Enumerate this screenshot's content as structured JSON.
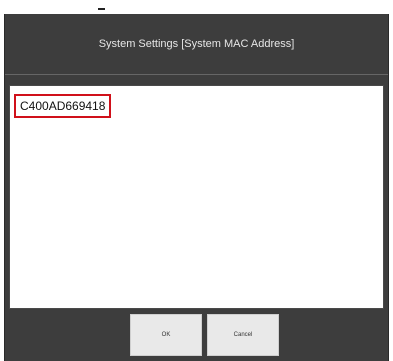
{
  "dialog": {
    "title": "System Settings [System MAC Address]",
    "value": "C400AD669418"
  },
  "buttons": {
    "ok_label": "OK",
    "cancel_label": "Cancel"
  },
  "colors": {
    "dialog_bg": "#3d3d3d",
    "highlight_border": "#d0101a",
    "button_bg": "#e9e9e9"
  }
}
